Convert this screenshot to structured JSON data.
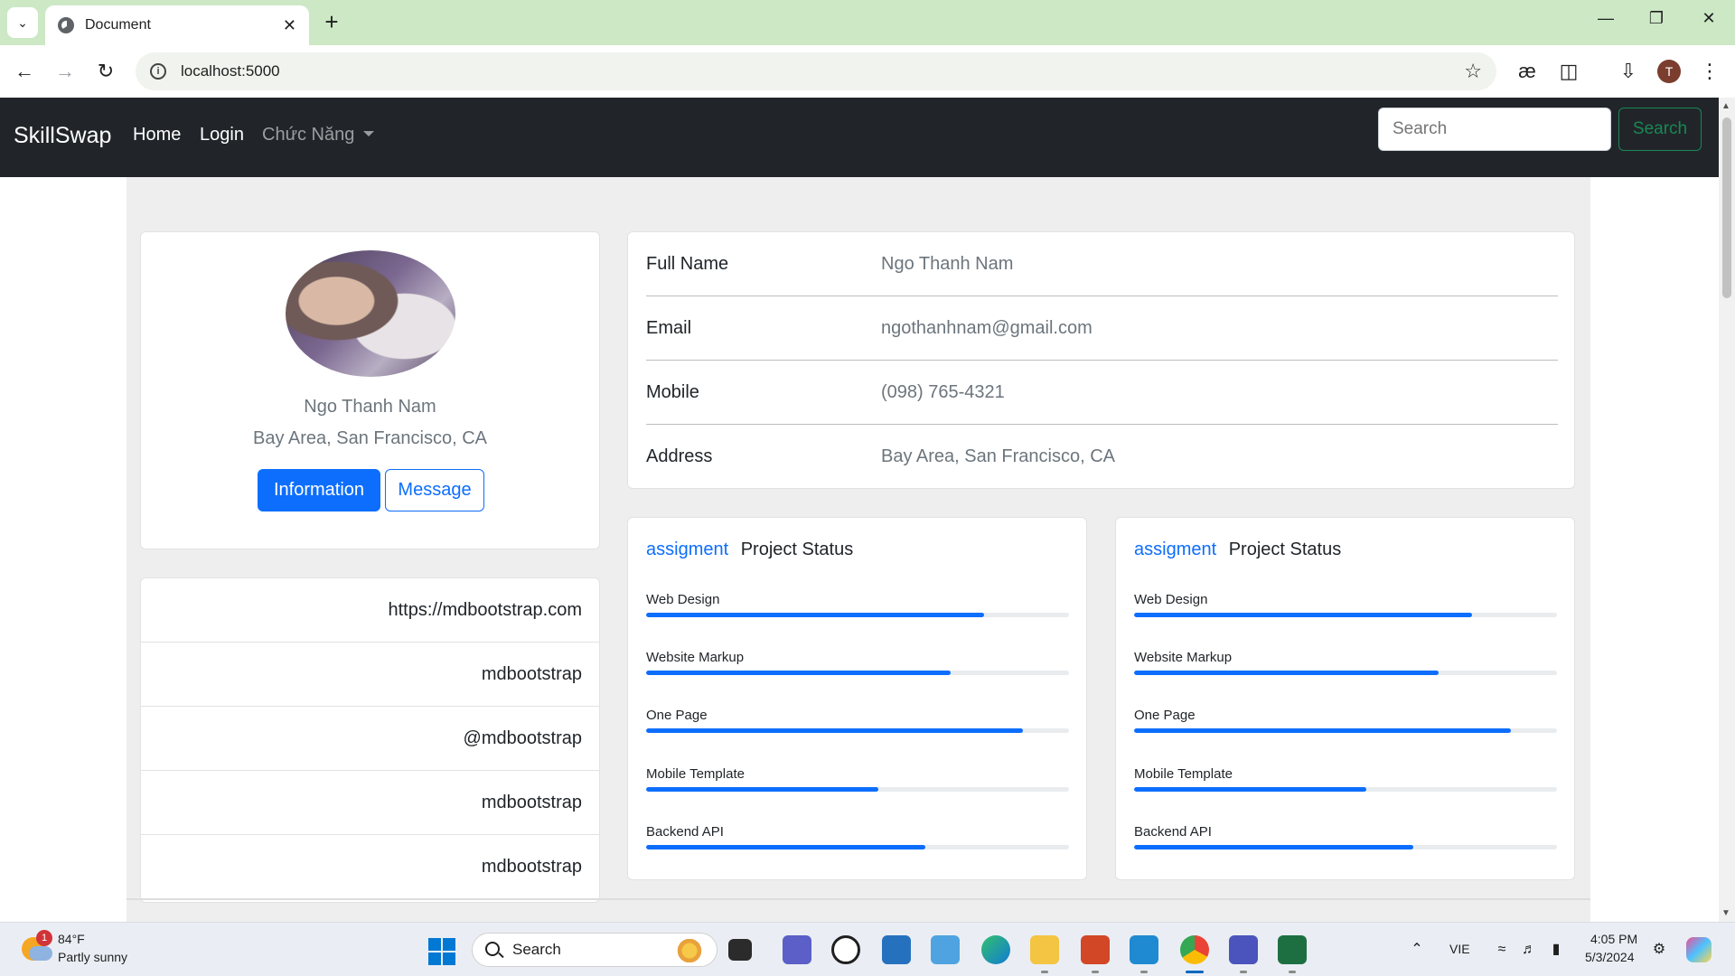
{
  "browser": {
    "tab_title": "Document",
    "tab_close": "✕",
    "new_tab": "+",
    "url": "localhost:5000",
    "profile_initial": "T",
    "window_controls": {
      "minimize": "—",
      "restore": "❐",
      "close": "✕"
    }
  },
  "nav": {
    "brand": "SkillSwap",
    "home": "Home",
    "login": "Login",
    "dropdown": "Chức Năng",
    "search_placeholder": "Search",
    "search_button": "Search"
  },
  "profile": {
    "name": "Ngo Thanh Nam",
    "location": "Bay Area, San Francisco, CA",
    "info_button": "Information",
    "message_button": "Message"
  },
  "links": [
    "https://mdbootstrap.com",
    "mdbootstrap",
    "@mdbootstrap",
    "mdbootstrap",
    "mdbootstrap"
  ],
  "details": [
    {
      "label": "Full Name",
      "value": "Ngo Thanh Nam"
    },
    {
      "label": "Email",
      "value": "ngothanhnam@gmail.com"
    },
    {
      "label": "Mobile",
      "value": "(098) 765-4321"
    },
    {
      "label": "Address",
      "value": "Bay Area, San Francisco, CA"
    }
  ],
  "projects": [
    {
      "assign_label": "assigment",
      "title": "Project Status",
      "items": [
        {
          "label": "Web Design",
          "progress": 80
        },
        {
          "label": "Website Markup",
          "progress": 72
        },
        {
          "label": "One Page",
          "progress": 89
        },
        {
          "label": "Mobile Template",
          "progress": 55
        },
        {
          "label": "Backend API",
          "progress": 66
        }
      ]
    },
    {
      "assign_label": "assigment",
      "title": "Project Status",
      "items": [
        {
          "label": "Web Design",
          "progress": 80
        },
        {
          "label": "Website Markup",
          "progress": 72
        },
        {
          "label": "One Page",
          "progress": 89
        },
        {
          "label": "Mobile Template",
          "progress": 55
        },
        {
          "label": "Backend API",
          "progress": 66
        }
      ]
    }
  ],
  "taskbar": {
    "weather_temp": "84°F",
    "weather_desc": "Partly sunny",
    "weather_badge": "1",
    "search_label": "Search",
    "language": "VIE",
    "time": "4:05 PM",
    "date": "5/3/2024"
  },
  "colors": {
    "primary": "#0d6efd",
    "success": "#198754",
    "navbar": "#212529",
    "tabstrip": "#cce8c5"
  }
}
